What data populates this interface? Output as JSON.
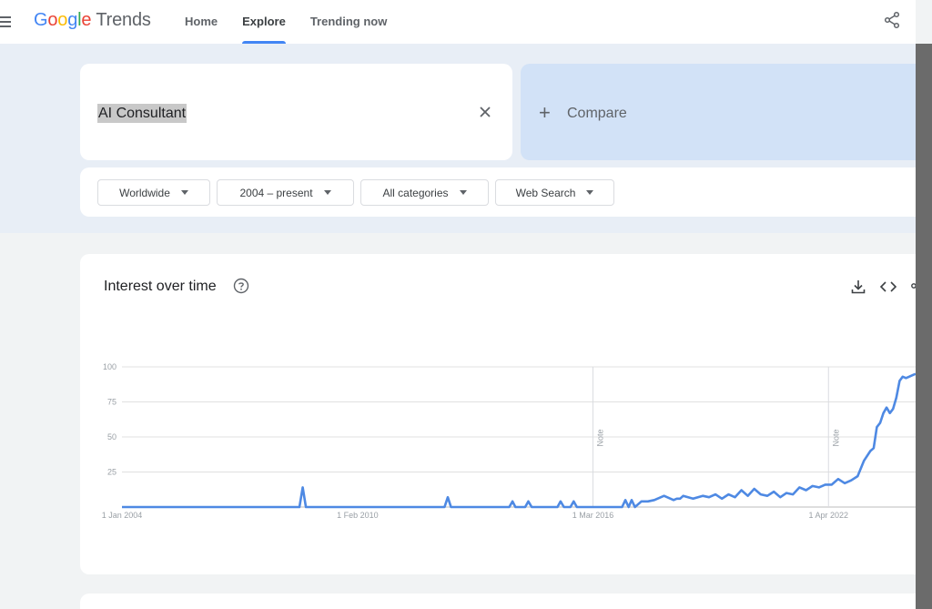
{
  "header": {
    "logo": {
      "google": [
        "G",
        "o",
        "o",
        "g",
        "l",
        "e"
      ],
      "product": "Trends"
    },
    "nav": [
      {
        "label": "Home",
        "active": false
      },
      {
        "label": "Explore",
        "active": true
      },
      {
        "label": "Trending now",
        "active": false
      }
    ]
  },
  "search": {
    "term": "AI Consultant",
    "compare_label": "Compare"
  },
  "filters": {
    "region": "Worldwide",
    "time": "2004 – present",
    "category": "All categories",
    "property": "Web Search"
  },
  "chart_section": {
    "title": "Interest over time"
  },
  "colors": {
    "accent": "#4285f4",
    "line": "#4e89e3",
    "band": "#e8eef6",
    "compare": "#d2e2f7"
  },
  "chart_data": {
    "type": "line",
    "title": "Interest over time",
    "y_ticks": [
      "100",
      "75",
      "50",
      "25"
    ],
    "ylim": [
      0,
      100
    ],
    "x_ticks": [
      "1 Jan 2004",
      "1 Feb 2010",
      "1 Mar 2016",
      "1 Apr 2022"
    ],
    "notes": [
      {
        "label": "Note",
        "date": "2016-03"
      },
      {
        "label": "Note",
        "date": "2022-04"
      }
    ],
    "grid": true,
    "series": [
      {
        "x": [
          "2004-01",
          "2005-01",
          "2006-01",
          "2007-01",
          "2008-01",
          "2008-08",
          "2008-09",
          "2008-10",
          "2008-11",
          "2009-06",
          "2010-02",
          "2011-01",
          "2012-01",
          "2012-05",
          "2012-06",
          "2012-07",
          "2013-06",
          "2014-01",
          "2014-02",
          "2014-03",
          "2014-06",
          "2014-07",
          "2014-08",
          "2015-04",
          "2015-05",
          "2015-06",
          "2015-08",
          "2015-09",
          "2015-10",
          "2016-03",
          "2016-12",
          "2017-01",
          "2017-02",
          "2017-03",
          "2017-04",
          "2017-06",
          "2017-07",
          "2017-08",
          "2017-10",
          "2018-01",
          "2018-04",
          "2018-05",
          "2018-06",
          "2018-07",
          "2018-10",
          "2019-01",
          "2019-03",
          "2019-05",
          "2019-07",
          "2019-09",
          "2019-11",
          "2020-01",
          "2020-03",
          "2020-05",
          "2020-07",
          "2020-09",
          "2020-11",
          "2021-01",
          "2021-03",
          "2021-05",
          "2021-07",
          "2021-09",
          "2021-11",
          "2022-01",
          "2022-03",
          "2022-05",
          "2022-07",
          "2022-09",
          "2022-11",
          "2023-01",
          "2023-03",
          "2023-05",
          "2023-06",
          "2023-07",
          "2023-08",
          "2023-09",
          "2023-10",
          "2023-11",
          "2023-12",
          "2024-01",
          "2024-02",
          "2024-03",
          "2024-04",
          "2024-05",
          "2024-06",
          "2024-07"
        ],
        "y": [
          0,
          0,
          0,
          0,
          0,
          0,
          14,
          0,
          0,
          0,
          0,
          0,
          0,
          0,
          7,
          0,
          0,
          0,
          4,
          0,
          0,
          4,
          0,
          0,
          4,
          0,
          0,
          4,
          0,
          0,
          0,
          5,
          0,
          5,
          0,
          4,
          4,
          4,
          5,
          8,
          5,
          6,
          6,
          8,
          6,
          8,
          7,
          9,
          6,
          9,
          7,
          12,
          8,
          13,
          9,
          8,
          11,
          7,
          10,
          9,
          14,
          12,
          15,
          14,
          16,
          16,
          20,
          17,
          19,
          22,
          33,
          40,
          42,
          57,
          60,
          67,
          71,
          67,
          70,
          78,
          90,
          93,
          92,
          93,
          94,
          95
        ]
      }
    ]
  }
}
